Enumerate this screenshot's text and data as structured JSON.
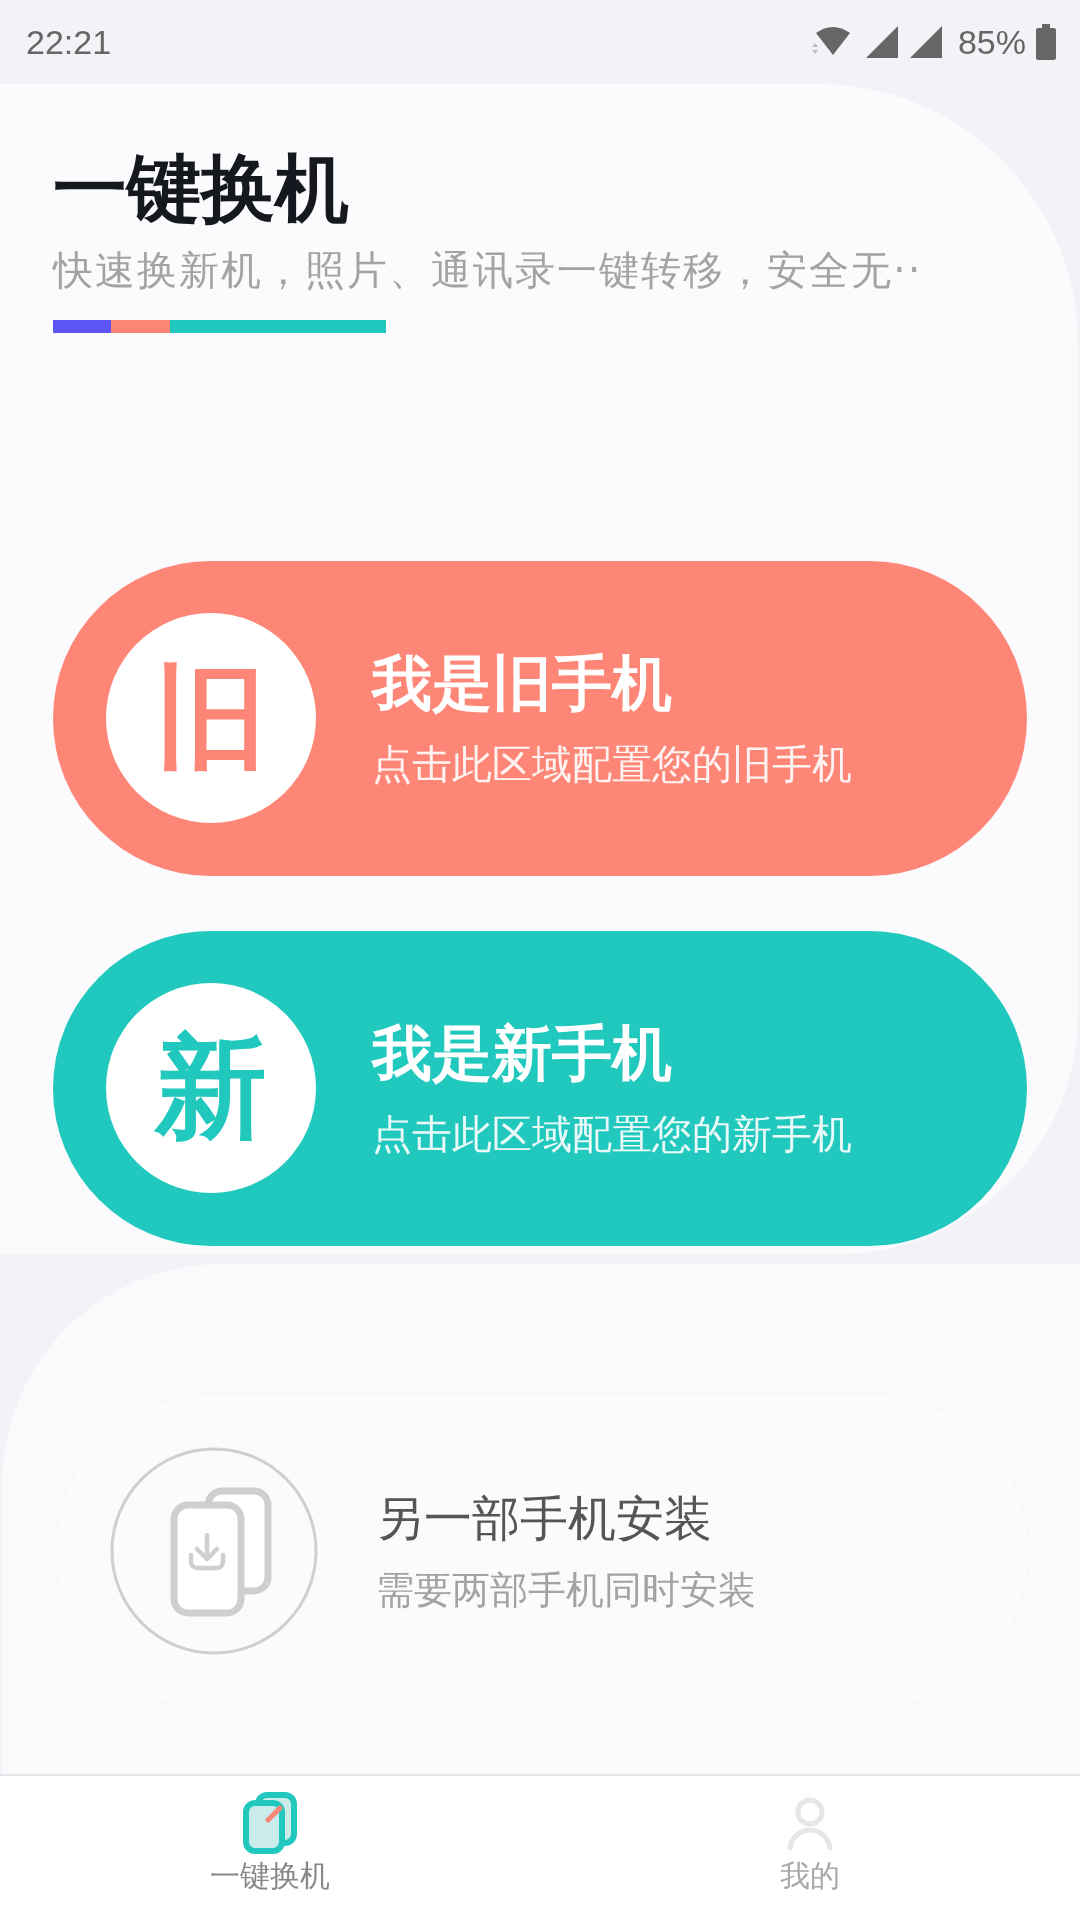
{
  "status_bar": {
    "time": "22:21",
    "battery": "85%"
  },
  "header": {
    "title": "一键换机",
    "subtitle": "快速换新机，照片、通讯录一键转移，安全无··"
  },
  "cards": [
    {
      "kind": "accent",
      "color": "#fe8677",
      "badge": "旧",
      "title": "我是旧手机",
      "subtitle": "点击此区域配置您的旧手机"
    },
    {
      "kind": "accent",
      "color": "#21c8bd",
      "badge": "新",
      "title": "我是新手机",
      "subtitle": "点击此区域配置您的新手机"
    },
    {
      "kind": "plain",
      "title": "另一部手机安装",
      "subtitle": "需要两部手机同时安装"
    }
  ],
  "tabs": [
    {
      "kind": "switch",
      "label": "一键换机",
      "selected": true
    },
    {
      "kind": "profile",
      "label": "我的",
      "selected": false
    }
  ]
}
